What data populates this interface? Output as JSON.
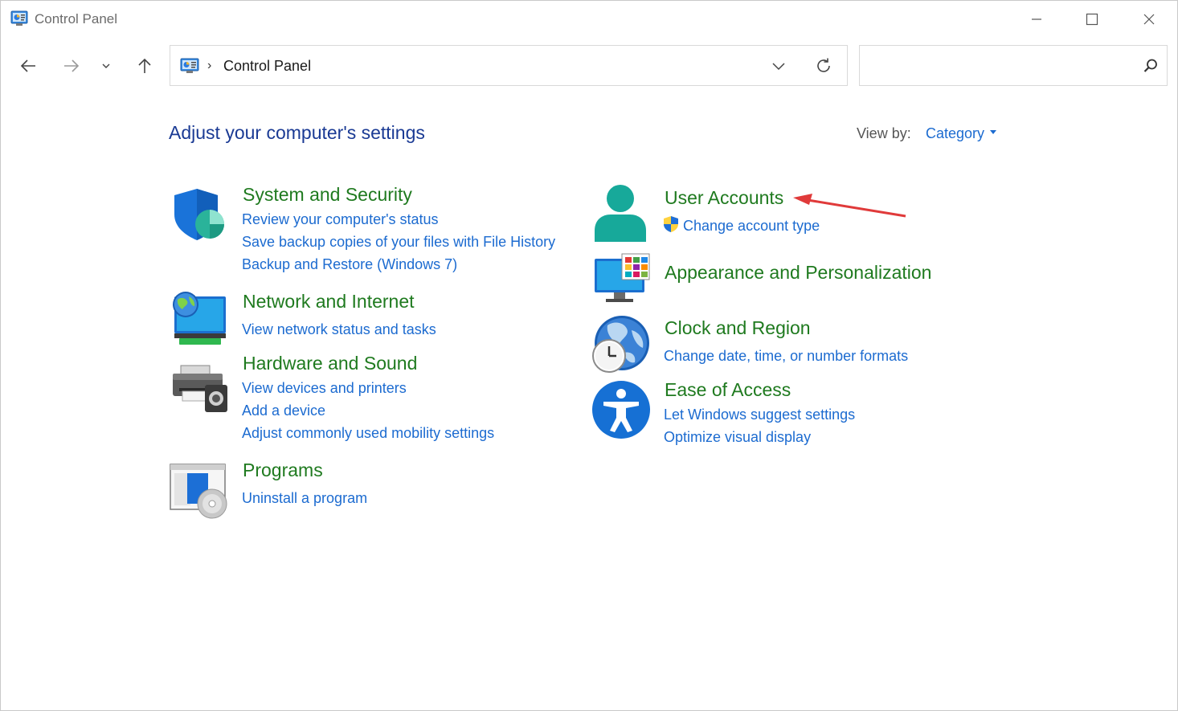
{
  "window": {
    "title": "Control Panel"
  },
  "address_bar": {
    "chevron": "›",
    "path": "Control Panel"
  },
  "search": {
    "placeholder": "",
    "value": ""
  },
  "main": {
    "heading": "Adjust your computer's settings",
    "view_by_label": "View by:",
    "view_by_value": "Category"
  },
  "categories": [
    {
      "title": "System and Security",
      "icon": "shield-icon",
      "links": [
        "Review your computer's status",
        "Save backup copies of your files with File History",
        "Backup and Restore (Windows 7)"
      ]
    },
    {
      "title": "Network and Internet",
      "icon": "network-globe-icon",
      "links": [
        "View network status and tasks"
      ]
    },
    {
      "title": "Hardware and Sound",
      "icon": "printer-speaker-icon",
      "links": [
        "View devices and printers",
        "Add a device",
        "Adjust commonly used mobility settings"
      ]
    },
    {
      "title": "Programs",
      "icon": "programs-disc-icon",
      "links": [
        "Uninstall a program"
      ]
    },
    {
      "title": "User Accounts",
      "icon": "user-icon",
      "links": [
        "Change account type"
      ]
    },
    {
      "title": "Appearance and Personalization",
      "icon": "monitor-palette-icon",
      "links": []
    },
    {
      "title": "Clock and Region",
      "icon": "globe-clock-icon",
      "links": [
        "Change date, time, or number formats"
      ]
    },
    {
      "title": "Ease of Access",
      "icon": "accessibility-icon",
      "links": [
        "Let Windows suggest settings",
        "Optimize visual display"
      ]
    }
  ],
  "colors": {
    "heading": "#1a3a94",
    "category_title": "#1f7a1f",
    "link": "#1c6bd0",
    "annotation_arrow": "#e03a3a"
  }
}
